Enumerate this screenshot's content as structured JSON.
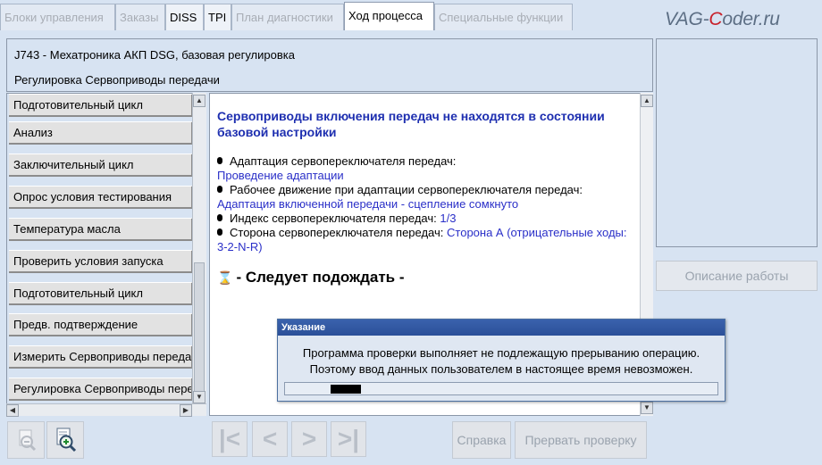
{
  "tabs": [
    {
      "label": "Блоки управления",
      "state": "disabled"
    },
    {
      "label": "Заказы",
      "state": "disabled"
    },
    {
      "label": "DISS",
      "state": "enabled"
    },
    {
      "label": "TPI",
      "state": "enabled"
    },
    {
      "label": "План диагностики",
      "state": "disabled"
    },
    {
      "label": "Ход процесса",
      "state": "active"
    },
    {
      "label": "Специальные функции",
      "state": "disabled"
    }
  ],
  "watermark": {
    "prefix": "VAG-",
    "accent": "C",
    "suffix": "oder.ru"
  },
  "header": {
    "line1": "J743 - Мехатроника АКП DSG, базовая регулировка",
    "line2": "Регулировка Сервоприводы передачи"
  },
  "steps": [
    "Подготовительный цикл",
    "Анализ",
    "Заключительный цикл",
    "Опрос условия тестирования",
    "Температура масла",
    "Проверить условия запуска",
    "Подготовительный цикл",
    "Предв. подтверждение",
    "Измерить Сервоприводы передачи",
    "Регулировка Сервоприводы передачи"
  ],
  "content": {
    "title": "Сервоприводы включения передач не находятся в состоянии базовой настройки",
    "items": [
      {
        "label": "Адаптация сервопереключателя передач:",
        "value": "Проведение адаптации"
      },
      {
        "label": "Рабочее движение при адаптации сервопереключателя передач:",
        "value": "Адаптация включенной передачи - сцепление сомкнуто"
      },
      {
        "label": "Индекс сервопереключателя передач:",
        "value": "1/3"
      },
      {
        "label": "Сторона сервопереключателя передач:",
        "value": "Сторона А (отрицательные ходы: 3-2-N-R)"
      }
    ],
    "wait": "- Следует подождать -"
  },
  "right_panel": {
    "description_button": "Описание работы"
  },
  "toolbar": {
    "help": "Справка",
    "abort": "Прервать проверку"
  },
  "dialog": {
    "title": "Указание",
    "message1": "Программа проверки выполняет не подлежащую прерыванию операцию.",
    "message2": "Поэтому ввод данных пользователем в настоящее время невозможен."
  },
  "colors": {
    "accent_blue": "#2a2fc8",
    "title_blue": "#1e2fb0",
    "dialog_title": "#2b4f98",
    "background": "#d7e3f2"
  }
}
